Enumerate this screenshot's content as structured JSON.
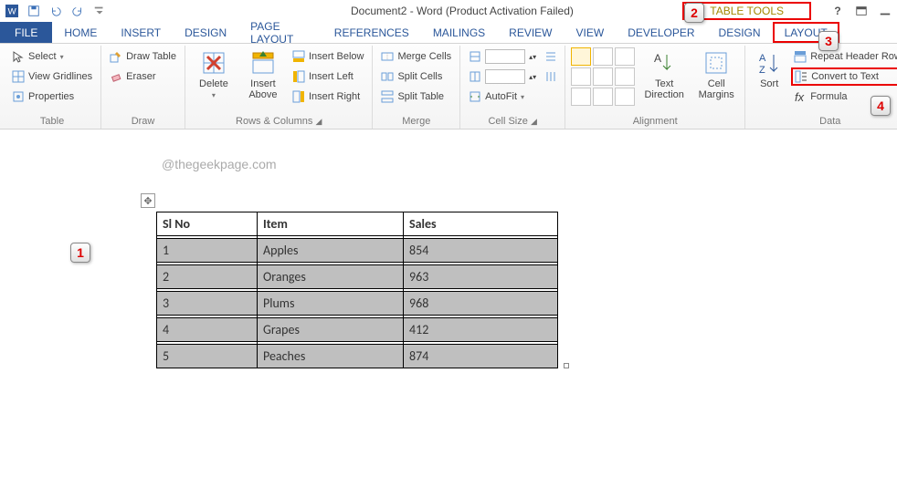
{
  "title": "Document2 - Word (Product Activation Failed)",
  "table_tools_label": "TABLE TOOLS",
  "tabs": {
    "file": "FILE",
    "home": "HOME",
    "insert": "INSERT",
    "design": "DESIGN",
    "page_layout": "PAGE LAYOUT",
    "references": "REFERENCES",
    "mailings": "MAILINGS",
    "review": "REVIEW",
    "view": "VIEW",
    "developer": "DEVELOPER",
    "tt_design": "DESIGN",
    "tt_layout": "LAYOUT"
  },
  "ribbon": {
    "table": {
      "label": "Table",
      "select": "Select",
      "gridlines": "View Gridlines",
      "properties": "Properties"
    },
    "draw": {
      "label": "Draw",
      "draw_table": "Draw Table",
      "eraser": "Eraser"
    },
    "rows_cols": {
      "label": "Rows & Columns",
      "delete": "Delete",
      "insert_above": "Insert Above",
      "insert_below": "Insert Below",
      "insert_left": "Insert Left",
      "insert_right": "Insert Right"
    },
    "merge": {
      "label": "Merge",
      "merge_cells": "Merge Cells",
      "split_cells": "Split Cells",
      "split_table": "Split Table"
    },
    "cell_size": {
      "label": "Cell Size",
      "autofit": "AutoFit"
    },
    "alignment": {
      "label": "Alignment",
      "text_direction": "Text Direction",
      "cell_margins": "Cell Margins"
    },
    "data": {
      "label": "Data",
      "sort": "Sort",
      "repeat_header": "Repeat Header Rows",
      "convert_to_text": "Convert to Text",
      "formula": "Formula"
    }
  },
  "watermark": "@thegeekpage.com",
  "chart_data": {
    "type": "table",
    "headers": [
      "Sl No",
      "Item",
      "Sales"
    ],
    "rows": [
      [
        "1",
        "Apples",
        "854"
      ],
      [
        "2",
        "Oranges",
        "963"
      ],
      [
        "3",
        "Plums",
        "968"
      ],
      [
        "4",
        "Grapes",
        "412"
      ],
      [
        "5",
        "Peaches",
        "874"
      ]
    ]
  },
  "annotations": {
    "b1": "1",
    "b2": "2",
    "b3": "3",
    "b4": "4"
  }
}
